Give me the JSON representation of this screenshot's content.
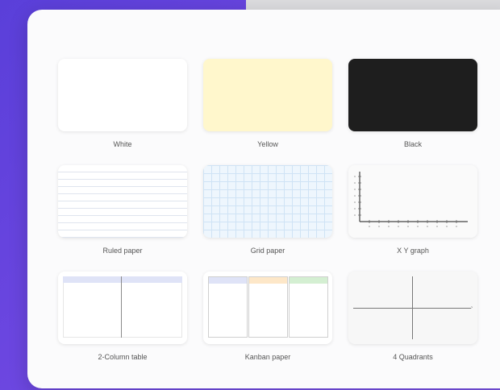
{
  "templates": [
    {
      "label": "White"
    },
    {
      "label": "Yellow"
    },
    {
      "label": "Black"
    },
    {
      "label": "Ruled paper"
    },
    {
      "label": "Grid paper"
    },
    {
      "label": "X Y graph"
    },
    {
      "label": "2-Column table"
    },
    {
      "label": "Kanban paper"
    },
    {
      "label": "4 Quadrants"
    }
  ],
  "colors": {
    "yellow": "#fff7cc",
    "black": "#1e1e1e",
    "kanban_todo": "#dfe3f7",
    "kanban_doing": "#fde7c8",
    "kanban_done": "#d4efd2"
  }
}
